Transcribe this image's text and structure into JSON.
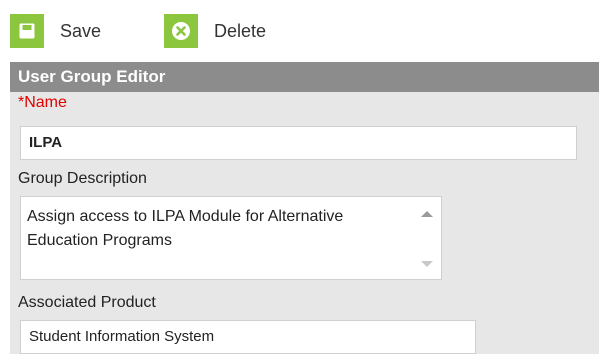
{
  "toolbar": {
    "save_label": "Save",
    "delete_label": "Delete",
    "accent_color": "#8cc63f"
  },
  "editor": {
    "title": "User Group Editor",
    "name_label": "*Name",
    "name_value": "ILPA",
    "description_label": "Group Description",
    "description_value": "Assign access to ILPA Module for Alternative Education Programs",
    "product_label": "Associated Product",
    "product_value": "Student Information System"
  }
}
